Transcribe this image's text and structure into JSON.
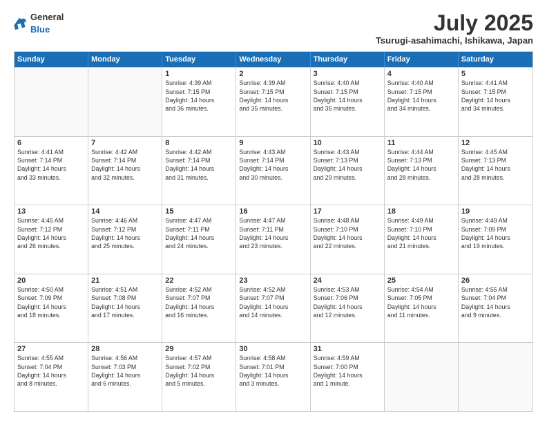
{
  "logo": {
    "general": "General",
    "blue": "Blue"
  },
  "title": "July 2025",
  "location": "Tsurugi-asahimachi, Ishikawa, Japan",
  "headers": [
    "Sunday",
    "Monday",
    "Tuesday",
    "Wednesday",
    "Thursday",
    "Friday",
    "Saturday"
  ],
  "rows": [
    [
      {
        "day": "",
        "info": ""
      },
      {
        "day": "",
        "info": ""
      },
      {
        "day": "1",
        "info": "Sunrise: 4:39 AM\nSunset: 7:15 PM\nDaylight: 14 hours\nand 36 minutes."
      },
      {
        "day": "2",
        "info": "Sunrise: 4:39 AM\nSunset: 7:15 PM\nDaylight: 14 hours\nand 35 minutes."
      },
      {
        "day": "3",
        "info": "Sunrise: 4:40 AM\nSunset: 7:15 PM\nDaylight: 14 hours\nand 35 minutes."
      },
      {
        "day": "4",
        "info": "Sunrise: 4:40 AM\nSunset: 7:15 PM\nDaylight: 14 hours\nand 34 minutes."
      },
      {
        "day": "5",
        "info": "Sunrise: 4:41 AM\nSunset: 7:15 PM\nDaylight: 14 hours\nand 34 minutes."
      }
    ],
    [
      {
        "day": "6",
        "info": "Sunrise: 4:41 AM\nSunset: 7:14 PM\nDaylight: 14 hours\nand 33 minutes."
      },
      {
        "day": "7",
        "info": "Sunrise: 4:42 AM\nSunset: 7:14 PM\nDaylight: 14 hours\nand 32 minutes."
      },
      {
        "day": "8",
        "info": "Sunrise: 4:42 AM\nSunset: 7:14 PM\nDaylight: 14 hours\nand 31 minutes."
      },
      {
        "day": "9",
        "info": "Sunrise: 4:43 AM\nSunset: 7:14 PM\nDaylight: 14 hours\nand 30 minutes."
      },
      {
        "day": "10",
        "info": "Sunrise: 4:43 AM\nSunset: 7:13 PM\nDaylight: 14 hours\nand 29 minutes."
      },
      {
        "day": "11",
        "info": "Sunrise: 4:44 AM\nSunset: 7:13 PM\nDaylight: 14 hours\nand 28 minutes."
      },
      {
        "day": "12",
        "info": "Sunrise: 4:45 AM\nSunset: 7:13 PM\nDaylight: 14 hours\nand 28 minutes."
      }
    ],
    [
      {
        "day": "13",
        "info": "Sunrise: 4:45 AM\nSunset: 7:12 PM\nDaylight: 14 hours\nand 26 minutes."
      },
      {
        "day": "14",
        "info": "Sunrise: 4:46 AM\nSunset: 7:12 PM\nDaylight: 14 hours\nand 25 minutes."
      },
      {
        "day": "15",
        "info": "Sunrise: 4:47 AM\nSunset: 7:11 PM\nDaylight: 14 hours\nand 24 minutes."
      },
      {
        "day": "16",
        "info": "Sunrise: 4:47 AM\nSunset: 7:11 PM\nDaylight: 14 hours\nand 23 minutes."
      },
      {
        "day": "17",
        "info": "Sunrise: 4:48 AM\nSunset: 7:10 PM\nDaylight: 14 hours\nand 22 minutes."
      },
      {
        "day": "18",
        "info": "Sunrise: 4:49 AM\nSunset: 7:10 PM\nDaylight: 14 hours\nand 21 minutes."
      },
      {
        "day": "19",
        "info": "Sunrise: 4:49 AM\nSunset: 7:09 PM\nDaylight: 14 hours\nand 19 minutes."
      }
    ],
    [
      {
        "day": "20",
        "info": "Sunrise: 4:50 AM\nSunset: 7:09 PM\nDaylight: 14 hours\nand 18 minutes."
      },
      {
        "day": "21",
        "info": "Sunrise: 4:51 AM\nSunset: 7:08 PM\nDaylight: 14 hours\nand 17 minutes."
      },
      {
        "day": "22",
        "info": "Sunrise: 4:52 AM\nSunset: 7:07 PM\nDaylight: 14 hours\nand 16 minutes."
      },
      {
        "day": "23",
        "info": "Sunrise: 4:52 AM\nSunset: 7:07 PM\nDaylight: 14 hours\nand 14 minutes."
      },
      {
        "day": "24",
        "info": "Sunrise: 4:53 AM\nSunset: 7:06 PM\nDaylight: 14 hours\nand 12 minutes."
      },
      {
        "day": "25",
        "info": "Sunrise: 4:54 AM\nSunset: 7:05 PM\nDaylight: 14 hours\nand 11 minutes."
      },
      {
        "day": "26",
        "info": "Sunrise: 4:55 AM\nSunset: 7:04 PM\nDaylight: 14 hours\nand 9 minutes."
      }
    ],
    [
      {
        "day": "27",
        "info": "Sunrise: 4:55 AM\nSunset: 7:04 PM\nDaylight: 14 hours\nand 8 minutes."
      },
      {
        "day": "28",
        "info": "Sunrise: 4:56 AM\nSunset: 7:03 PM\nDaylight: 14 hours\nand 6 minutes."
      },
      {
        "day": "29",
        "info": "Sunrise: 4:57 AM\nSunset: 7:02 PM\nDaylight: 14 hours\nand 5 minutes."
      },
      {
        "day": "30",
        "info": "Sunrise: 4:58 AM\nSunset: 7:01 PM\nDaylight: 14 hours\nand 3 minutes."
      },
      {
        "day": "31",
        "info": "Sunrise: 4:59 AM\nSunset: 7:00 PM\nDaylight: 14 hours\nand 1 minute."
      },
      {
        "day": "",
        "info": ""
      },
      {
        "day": "",
        "info": ""
      }
    ]
  ]
}
